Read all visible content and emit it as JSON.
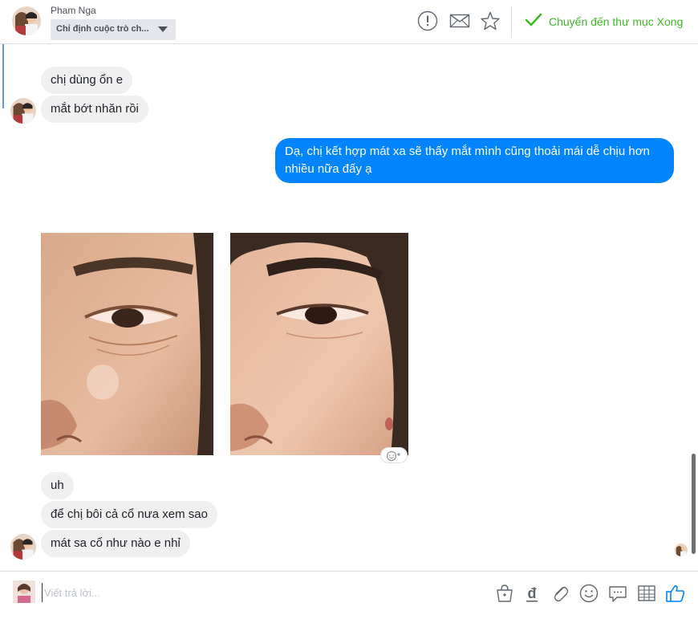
{
  "header": {
    "contact_name": "Pham Nga",
    "assign_label": "Chỉ định cuộc trò ch...",
    "done_label": "Chuyển đến thư mục Xong",
    "icons": [
      "alert-icon",
      "envelope-icon",
      "star-icon",
      "checkmark-icon"
    ]
  },
  "messages": {
    "m1": "chị dùng ổn e",
    "m2": "mắt bớt nhăn rồi",
    "m3": "Dạ, chị kết hợp mát xa sẽ thấy mắt mình cũng thoải mái dễ chịu hơn nhiều nữa đấy ạ",
    "m4": "uh",
    "m5": "để chị bôi cả cổ nưa xem sao",
    "m6": "mát sa cổ như nào e nhỉ"
  },
  "composer": {
    "placeholder": "Viết trả lời...",
    "tools": [
      "shop-bag-icon",
      "currency-dong-icon",
      "paperclip-icon",
      "smiley-icon",
      "chat-bubble-icon",
      "table-icon",
      "thumbs-up-icon"
    ]
  },
  "colors": {
    "accent": "#0084ff",
    "done_green": "#42b72a",
    "incoming_bubble": "#f1f0f0"
  }
}
